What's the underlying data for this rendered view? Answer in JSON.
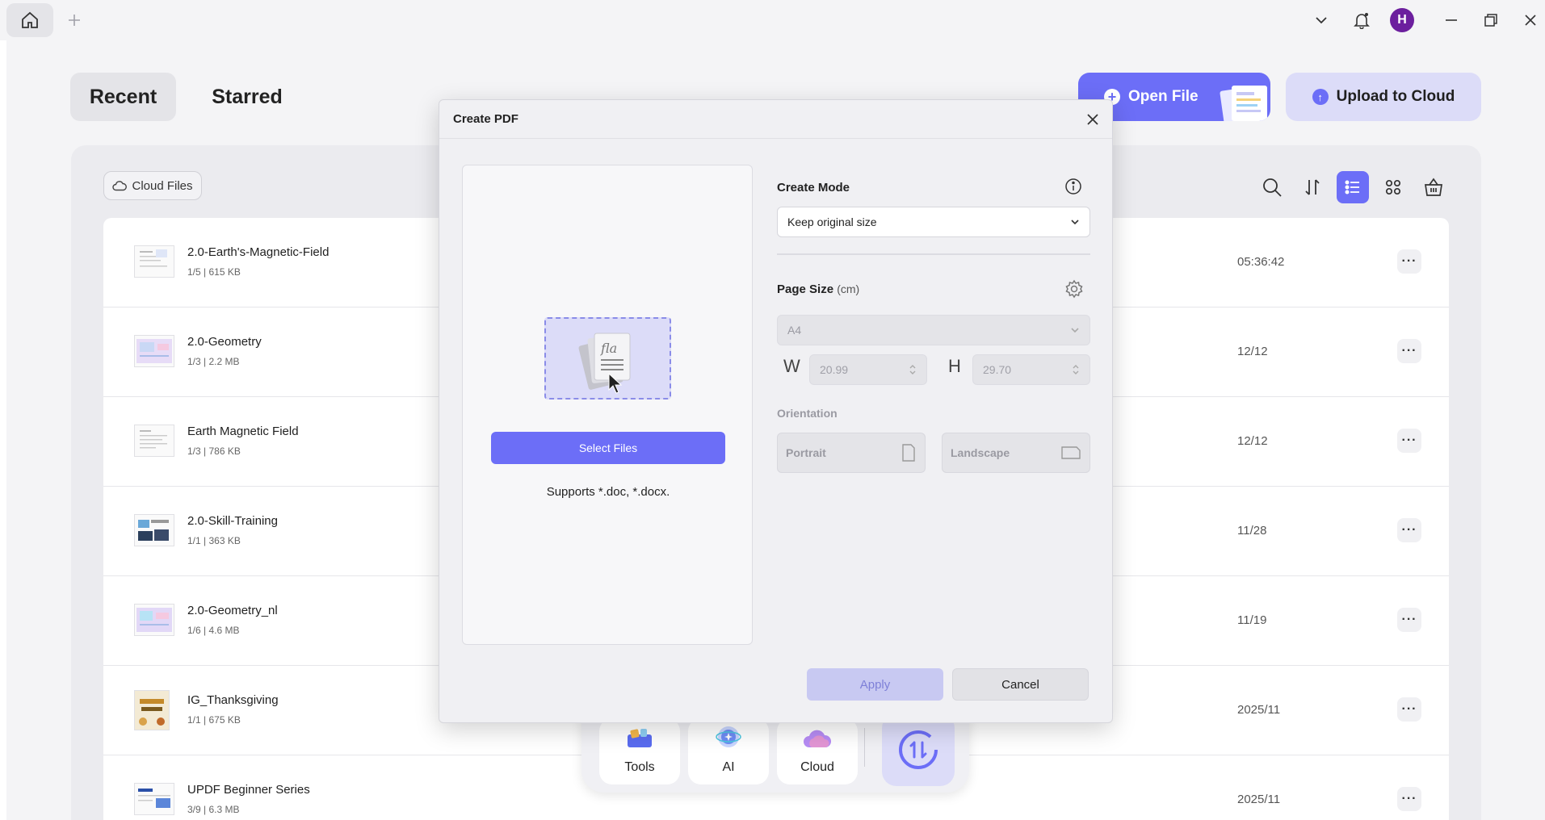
{
  "titlebar": {
    "avatar_letter": "H"
  },
  "tabs": {
    "recent": "Recent",
    "starred": "Starred"
  },
  "actions": {
    "open_file": "Open File",
    "upload_cloud": "Upload to Cloud"
  },
  "toolbar": {
    "cloud_files": "Cloud Files"
  },
  "files": [
    {
      "name": "2.0-Earth's-Magnetic-Field",
      "meta": "1/5 | 615 KB",
      "date": "05:36:42"
    },
    {
      "name": "2.0-Geometry",
      "meta": "1/3 | 2.2 MB",
      "date": "12/12"
    },
    {
      "name": "Earth Magnetic Field",
      "meta": "1/3 | 786 KB",
      "date": "12/12"
    },
    {
      "name": "2.0-Skill-Training",
      "meta": "1/1 | 363 KB",
      "date": "11/28"
    },
    {
      "name": "2.0-Geometry_nl",
      "meta": "1/6 | 4.6 MB",
      "date": "11/19"
    },
    {
      "name": "IG_Thanksgiving",
      "meta": "1/1 | 675 KB",
      "date": "2025/11"
    },
    {
      "name": "UPDF Beginner Series",
      "meta": "3/9 | 6.3 MB",
      "date": "2025/11"
    }
  ],
  "dock": {
    "tools": "Tools",
    "ai": "AI",
    "cloud": "Cloud"
  },
  "modal": {
    "title": "Create PDF",
    "select_files": "Select Files",
    "supports": "Supports *.doc, *.docx.",
    "create_mode_label": "Create Mode",
    "create_mode_value": "Keep original size",
    "page_size_label": "Page Size",
    "page_size_unit": "(cm)",
    "page_size_value": "A4",
    "width_letter": "W",
    "width_value": "20.99",
    "height_letter": "H",
    "height_value": "29.70",
    "orientation_label": "Orientation",
    "portrait": "Portrait",
    "landscape": "Landscape",
    "apply": "Apply",
    "cancel": "Cancel"
  },
  "colors": {
    "accent": "#6c6ef7",
    "accent_light": "#dcdcf8",
    "avatar": "#6c1f9e"
  }
}
